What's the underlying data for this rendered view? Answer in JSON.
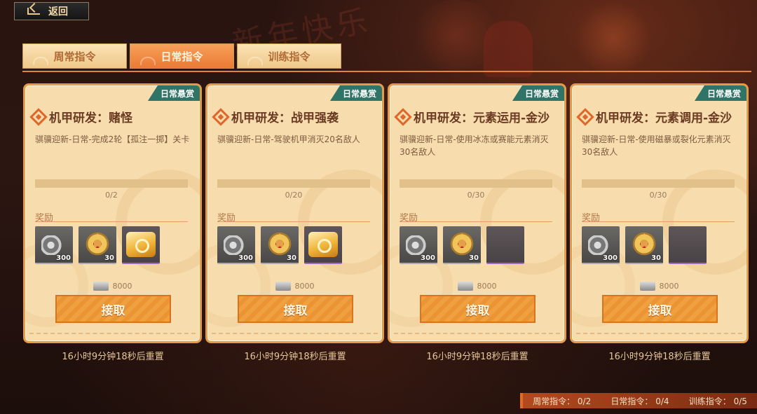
{
  "back": {
    "label": "返回"
  },
  "tabs": [
    {
      "label": "周常指令",
      "active": false
    },
    {
      "label": "日常指令",
      "active": true
    },
    {
      "label": "训练指令",
      "active": false
    }
  ],
  "cards": [
    {
      "tag": "日常悬赏",
      "title": "机甲研发：赌怪",
      "description": "骐骥迎新-日常-完成2轮【孤注一掷】关卡",
      "progress": {
        "current": 0,
        "total": 2,
        "text": "0/2"
      },
      "reward_label": "奖励",
      "rewards": [
        {
          "icon": "gear-parts-icon",
          "count": "300"
        },
        {
          "icon": "gold-medal-icon",
          "count": "30"
        },
        {
          "icon": "gold-chest-icon",
          "count": ""
        }
      ],
      "cost": "8000",
      "claim_label": "接取",
      "reset": "16小时9分钟18秒后重置"
    },
    {
      "tag": "日常悬赏",
      "title": "机甲研发：战甲强袭",
      "description": "骐骥迎新-日常-驾驶机甲消灭20名敌人",
      "progress": {
        "current": 0,
        "total": 20,
        "text": "0/20"
      },
      "reward_label": "奖励",
      "rewards": [
        {
          "icon": "gear-parts-icon",
          "count": "300"
        },
        {
          "icon": "gold-medal-icon",
          "count": "30"
        },
        {
          "icon": "gold-chest-icon",
          "count": ""
        }
      ],
      "cost": "8000",
      "claim_label": "接取",
      "reset": "16小时9分钟18秒后重置"
    },
    {
      "tag": "日常悬赏",
      "title": "机甲研发：元素运用-金沙",
      "description": "骐骥迎新-日常-使用冰冻或赛能元素消灭30名敌人",
      "progress": {
        "current": 0,
        "total": 30,
        "text": "0/30"
      },
      "reward_label": "奖励",
      "rewards": [
        {
          "icon": "gear-parts-icon",
          "count": "300"
        },
        {
          "icon": "gold-medal-icon",
          "count": "30"
        },
        {
          "icon": "empty-slot",
          "count": ""
        }
      ],
      "cost": "8000",
      "claim_label": "接取",
      "reset": "16小时9分钟18秒后重置"
    },
    {
      "tag": "日常悬赏",
      "title": "机甲研发：元素调用-金沙",
      "description": "骐骥迎新-日常-使用磁暴或裂化元素消灭30名敌人",
      "progress": {
        "current": 0,
        "total": 30,
        "text": "0/30"
      },
      "reward_label": "奖励",
      "rewards": [
        {
          "icon": "gear-parts-icon",
          "count": "300"
        },
        {
          "icon": "gold-medal-icon",
          "count": "30"
        },
        {
          "icon": "empty-slot",
          "count": ""
        }
      ],
      "cost": "8000",
      "claim_label": "接取",
      "reset": "16小时9分钟18秒后重置"
    }
  ],
  "summary": {
    "weekly": "周常指令：  0/2",
    "daily": "日常指令：  0/4",
    "training": "训练指令：  0/5"
  },
  "background": {
    "banner_text": "新年快乐"
  },
  "colors": {
    "accent_orange": "#e07a30",
    "tag_teal": "#2f7466",
    "card_bg": "#f7dcae"
  }
}
